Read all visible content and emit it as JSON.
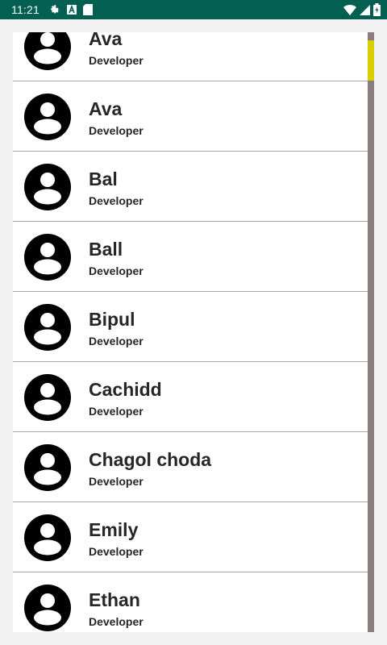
{
  "status_bar": {
    "time": "11:21",
    "icons_left": [
      "gear-icon",
      "a-badge-icon",
      "sd-card-icon"
    ],
    "icons_right": [
      "wifi-icon",
      "signal-icon",
      "battery-icon"
    ],
    "background": "#035f52"
  },
  "contacts": [
    {
      "name": "Ava",
      "role": "Developer"
    },
    {
      "name": "Ava",
      "role": "Developer"
    },
    {
      "name": "Bal",
      "role": "Developer"
    },
    {
      "name": "Ball",
      "role": "Developer"
    },
    {
      "name": "Bipul",
      "role": "Developer"
    },
    {
      "name": "Cachidd",
      "role": "Developer"
    },
    {
      "name": "Chagol choda",
      "role": "Developer"
    },
    {
      "name": "Emily",
      "role": "Developer"
    },
    {
      "name": "Ethan",
      "role": "Developer"
    }
  ],
  "colors": {
    "scrollbar_track": "#8a7e7e",
    "scrollbar_thumb": "#d8cf00"
  }
}
